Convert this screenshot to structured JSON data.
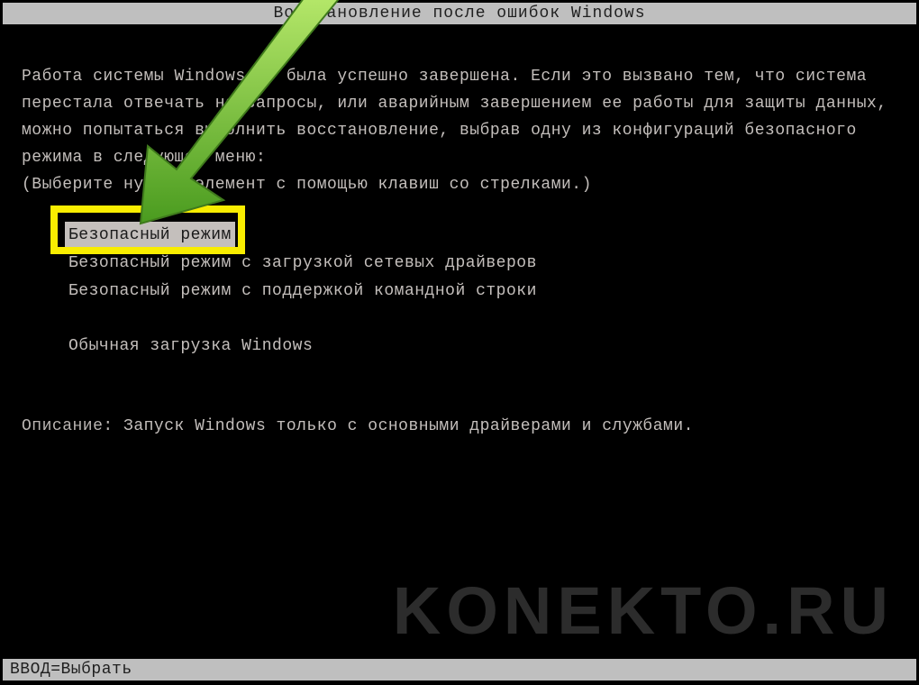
{
  "title": "Восстановление после ошибок Windows",
  "paragraph": "Работа системы Windows не была успешно завершена. Если это вызвано тем, что система перестала отвечать на запросы, или аварийным завершением ее работы для защиты данных, можно попытаться выполнить восстановление, выбрав одну из конфигураций безопасного режима в следующем меню:",
  "instruction": "(Выберите нужный элемент с помощью клавиш со стрелками.)",
  "menu": {
    "items": [
      "Безопасный режим",
      "Безопасный режим с загрузкой сетевых драйверов",
      "Безопасный режим с поддержкой командной строки",
      "Обычная загрузка Windows"
    ],
    "selected_index": 0
  },
  "description": {
    "label": "Описание:",
    "text": "Запуск Windows только с основными драйверами и службами."
  },
  "footer": "ВВОД=Выбрать",
  "watermark": "KONEKTO.RU",
  "colors": {
    "highlight": "#f9ed00",
    "arrow_fill": "#7fd13b",
    "arrow_stroke": "#4a7f22"
  }
}
